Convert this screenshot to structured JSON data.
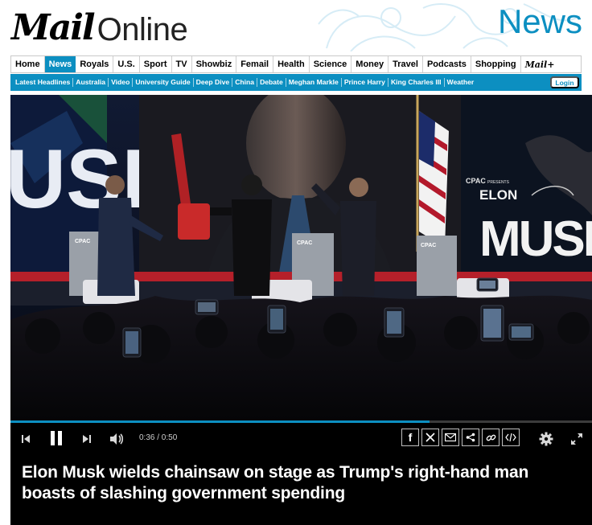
{
  "brand": {
    "logo_main": "Mail",
    "logo_secondary": "Online",
    "section": "News"
  },
  "nav_primary": [
    {
      "label": "Home",
      "active": false
    },
    {
      "label": "News",
      "active": true
    },
    {
      "label": "Royals",
      "active": false
    },
    {
      "label": "U.S.",
      "active": false
    },
    {
      "label": "Sport",
      "active": false
    },
    {
      "label": "TV",
      "active": false
    },
    {
      "label": "Showbiz",
      "active": false
    },
    {
      "label": "Femail",
      "active": false
    },
    {
      "label": "Health",
      "active": false
    },
    {
      "label": "Science",
      "active": false
    },
    {
      "label": "Money",
      "active": false
    },
    {
      "label": "Travel",
      "active": false
    },
    {
      "label": "Podcasts",
      "active": false
    },
    {
      "label": "Shopping",
      "active": false
    },
    {
      "label": "Mail+",
      "active": false
    }
  ],
  "nav_secondary": [
    "Latest Headlines",
    "Australia",
    "Video",
    "University Guide",
    "Deep Dive",
    "China",
    "Debate",
    "Meghan Markle",
    "Prince Harry",
    "King Charles III",
    "Weather"
  ],
  "login_label": "Login",
  "video": {
    "screen_text_name": "ELON",
    "screen_text_surname": "MUSK",
    "screen_text_left": "USK",
    "cpac_label": "CPAC",
    "cpac_presents": "PRESENTS",
    "current_time": "0:36",
    "duration": "0:50",
    "time_display": "0:36 / 0:50",
    "progress_fraction": 0.72
  },
  "player_controls": {
    "icons": [
      "previous-icon",
      "pause-icon",
      "next-icon",
      "volume-icon",
      "settings-icon",
      "fullscreen-icon"
    ],
    "share_icons": [
      "facebook-icon",
      "x-icon",
      "email-icon",
      "share-icon",
      "link-icon",
      "embed-icon"
    ]
  },
  "headline": "Elon Musk wields chainsaw on stage as Trump's right-hand man boasts of slashing government spending",
  "colors": {
    "brand_blue": "#0c8fc1",
    "player_bg": "#000000"
  }
}
